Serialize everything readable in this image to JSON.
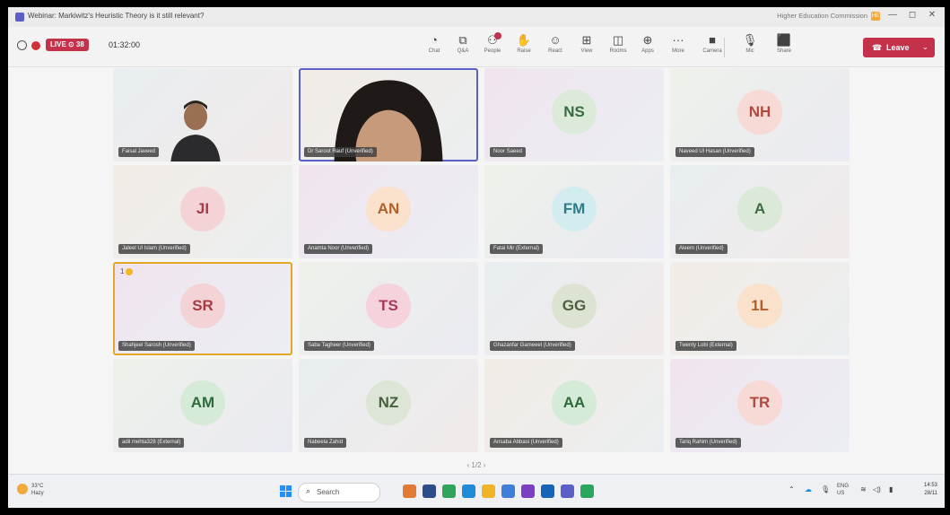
{
  "window": {
    "title": "Webinar: Markiwitz's Heuristic Theory is it still relevant?",
    "org_name": "Higher Education Commission",
    "org_avatar": "HE",
    "minimize": "—",
    "maximize": "◻",
    "close": "✕"
  },
  "meeting": {
    "live_badge": "LIVE ⊙ 38",
    "timer": "01:32:00",
    "tools": [
      {
        "name": "chat",
        "icon": "chat-icon",
        "glyph": "◔",
        "label": "Chat"
      },
      {
        "name": "qa",
        "icon": "qa-icon",
        "glyph": "⧉",
        "label": "Q&A"
      },
      {
        "name": "people",
        "icon": "people-icon",
        "glyph": "⚇",
        "label": "People"
      },
      {
        "name": "raise",
        "icon": "raise-hand-icon",
        "glyph": "✋",
        "label": "Raise"
      },
      {
        "name": "react",
        "icon": "react-icon",
        "glyph": "☺",
        "label": "React"
      },
      {
        "name": "view",
        "icon": "view-icon",
        "glyph": "⊞",
        "label": "View"
      },
      {
        "name": "rooms",
        "icon": "rooms-icon",
        "glyph": "◫",
        "label": "Rooms"
      },
      {
        "name": "apps",
        "icon": "apps-icon",
        "glyph": "⊕",
        "label": "Apps"
      },
      {
        "name": "more",
        "icon": "more-icon",
        "glyph": "···",
        "label": "More"
      },
      {
        "name": "camera",
        "icon": "camera-icon",
        "glyph": "■",
        "label": "Camera"
      },
      {
        "name": "mic",
        "icon": "mic-icon",
        "glyph": "🎙",
        "label": "Mic"
      },
      {
        "name": "share",
        "icon": "share-icon",
        "glyph": "⬛",
        "label": "Share"
      }
    ],
    "leave_label": "Leave",
    "leave_icon": "phone-hangup-icon",
    "pager": "‹  1/2  ›"
  },
  "participants": [
    {
      "initials": "",
      "name": "Faisal Javeed",
      "video": "male"
    },
    {
      "initials": "",
      "name": "Dr Saroot Rauf (Unverified)",
      "video": "female"
    },
    {
      "initials": "NS",
      "name": "Noor Saeed",
      "color": "#dcebd9",
      "text": "#3a6b40"
    },
    {
      "initials": "NH",
      "name": "Naveed Ul Hasan (Unverified)",
      "color": "#f7d9d6",
      "text": "#b04a3c"
    },
    {
      "initials": "JI",
      "name": "Jaleel Ul Islam (Unverified)",
      "color": "#f4d3d6",
      "text": "#a83a44"
    },
    {
      "initials": "AN",
      "name": "Anamta Noor (Unverified)",
      "color": "#f9e1cb",
      "text": "#b0602a"
    },
    {
      "initials": "FM",
      "name": "Fatai Mir (External)",
      "color": "#d3ecef",
      "text": "#2f7d88"
    },
    {
      "initials": "A",
      "name": "Aleem (Unverified)",
      "color": "#dbe9d8",
      "text": "#3f6b44"
    },
    {
      "initials": "SR",
      "name": "Shahjeel Sarosh (Unverified)",
      "color": "#f4d3d6",
      "text": "#a83a44",
      "hand": "1"
    },
    {
      "initials": "TS",
      "name": "Saba Tagheer (Unverified)",
      "color": "#f6d2dc",
      "text": "#a63a5c"
    },
    {
      "initials": "GG",
      "name": "Ghazanfar Gameeel (Unverified)",
      "color": "#dde3d3",
      "text": "#4e6040"
    },
    {
      "initials": "1L",
      "name": "Twenty Lobi (External)",
      "color": "#f9e1cb",
      "text": "#b0602a"
    },
    {
      "initials": "AM",
      "name": "adil mehta328 (External)",
      "color": "#d6ead8",
      "text": "#2f6b3a"
    },
    {
      "initials": "NZ",
      "name": "Nabeela Zahid",
      "color": "#dde6d6",
      "text": "#45603e"
    },
    {
      "initials": "AA",
      "name": "Ansaba Abbasi (Unverified)",
      "color": "#d6ead8",
      "text": "#2f6b3a"
    },
    {
      "initials": "TR",
      "name": "Tariq Rahim (Unverified)",
      "color": "#f7d9d6",
      "text": "#b04a3c"
    }
  ],
  "taskbar": {
    "weather_temp": "33°C",
    "weather_desc": "Hazy",
    "search_placeholder": "Search",
    "search_icon": "search-icon",
    "apps": [
      {
        "name": "media-app-icon",
        "color": "#e07a35"
      },
      {
        "name": "file-explorer-icon",
        "color": "#2d4c8a"
      },
      {
        "name": "chrome-icon",
        "color": "#2fa35a"
      },
      {
        "name": "edge-icon",
        "color": "#1f8ad6"
      },
      {
        "name": "folder-icon",
        "color": "#f0b429"
      },
      {
        "name": "photos-icon",
        "color": "#3f7fd9"
      },
      {
        "name": "visual-studio-icon",
        "color": "#7a3fc2"
      },
      {
        "name": "outlook-icon",
        "color": "#1763b8"
      },
      {
        "name": "teams-icon",
        "color": "#5b5fc7"
      },
      {
        "name": "chrome-alt-icon",
        "color": "#2aa55e"
      }
    ],
    "lang": "ENG",
    "region": "US",
    "time": "14:53",
    "date": "28/11"
  }
}
